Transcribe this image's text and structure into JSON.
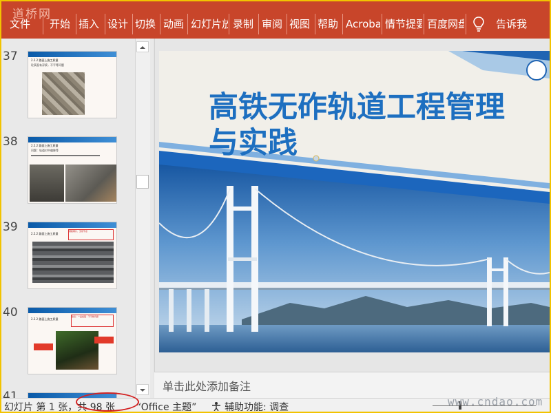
{
  "watermark_top": "道桥网",
  "ribbon": {
    "tabs": [
      {
        "label": "文件"
      },
      {
        "label": "开始"
      },
      {
        "label": "插入"
      },
      {
        "label": "设计"
      },
      {
        "label": "切换"
      },
      {
        "label": "动画"
      },
      {
        "label": "幻灯片放"
      },
      {
        "label": "录制"
      },
      {
        "label": "审阅"
      },
      {
        "label": "视图"
      },
      {
        "label": "帮助"
      },
      {
        "label": "Acrobat"
      },
      {
        "label": "情节提要"
      },
      {
        "label": "百度网盘"
      }
    ],
    "tell_me": "告诉我"
  },
  "thumbnails": [
    {
      "number": "37",
      "heading": "2.2.2 路面上施工质量",
      "caption": "砼表面有浮浆，不平等问题"
    },
    {
      "number": "38",
      "heading": "2.2.2 路面上施工质量",
      "caption": "问题：轨道对中偏移等"
    },
    {
      "number": "39",
      "heading": "2.2.2 路面上施工质量",
      "caption": "钢筋网片，无效节点"
    },
    {
      "number": "40",
      "heading": "2.2.2 路面上施工质量",
      "caption": "建议：一是加强...不平整问题"
    },
    {
      "number": "41"
    }
  ],
  "slide": {
    "title_line1": "高铁无砟轨道工程管理",
    "title_line2": "与实践"
  },
  "notes_placeholder": "单击此处添加备注",
  "status": {
    "slide_info": "幻灯片 第 1 张，共 98 张",
    "theme": "“Office 主题”",
    "accessibility": "辅助功能: 调查"
  },
  "watermark_bottom": "www.cndao.com",
  "colors": {
    "ribbon": "#c8452a",
    "title": "#1d6fc0",
    "highlight_circle": "#d32222",
    "frame": "#f2c300"
  }
}
